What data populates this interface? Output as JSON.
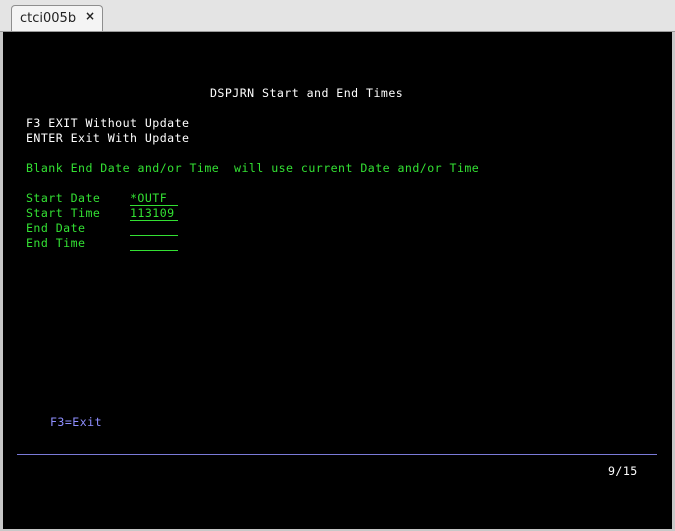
{
  "tab": {
    "title": "ctci005b",
    "close_glyph": "×"
  },
  "screen": {
    "title": "DSPJRN Start and End Times",
    "instructions": [
      "F3 EXIT Without Update",
      "ENTER Exit With Update"
    ],
    "note": "Blank End Date and/or Time  will use current Date and/or Time",
    "fields": [
      {
        "label": "Start Date",
        "value": "*OUTF"
      },
      {
        "label": "Start Time",
        "value": "113109"
      },
      {
        "label": "End Date",
        "value": ""
      },
      {
        "label": "End Time",
        "value": ""
      }
    ],
    "function_keys": "F3=Exit",
    "page_indicator": "9/15"
  },
  "colors": {
    "background": "#000000",
    "text_white": "#ffffff",
    "text_green": "#33e033",
    "text_blue": "#8f8fff"
  }
}
